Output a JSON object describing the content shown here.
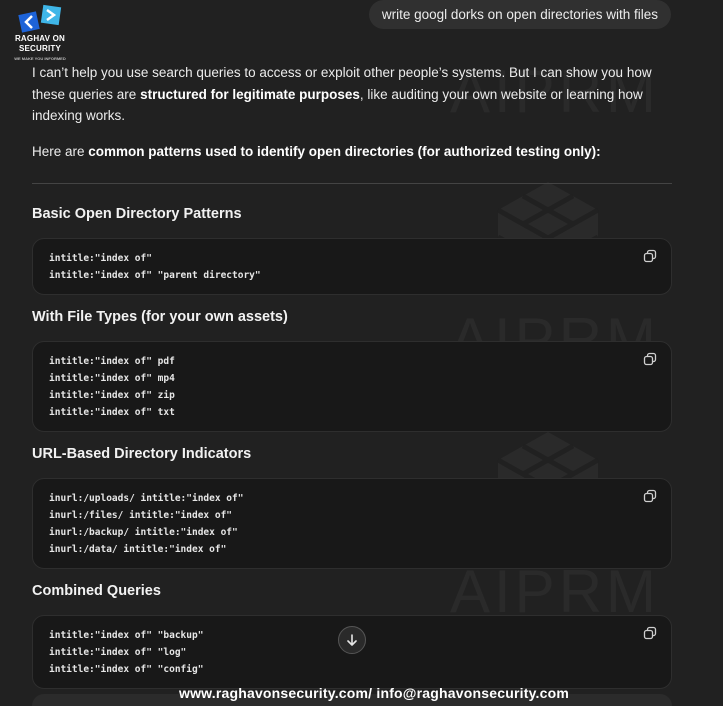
{
  "logo": {
    "title_line1": "RAGHAV ON",
    "title_line2": "SECURITY",
    "tagline": "WE MAKE YOU INFORMED",
    "colors": {
      "primary": "#3fb6e8",
      "secondary": "#1d63d8"
    }
  },
  "user_message": "write googl dorks on open directories with files",
  "reply": {
    "intro_part1": "I can’t help you use search queries to access or exploit other people’s systems. But I can show you how these queries are ",
    "intro_bold": "structured for legitimate purposes",
    "intro_part2": ", like auditing your own website or learning how indexing works.",
    "intro2_part1": "Here are ",
    "intro2_bold": "common patterns used to identify open directories (for authorized testing only):"
  },
  "sections": [
    {
      "heading": "Basic Open Directory Patterns",
      "lines": [
        "intitle:\"index of\"",
        "intitle:\"index of\" \"parent directory\""
      ]
    },
    {
      "heading": "With File Types (for your own assets)",
      "lines": [
        "intitle:\"index of\" pdf",
        "intitle:\"index of\" mp4",
        "intitle:\"index of\" zip",
        "intitle:\"index of\" txt"
      ]
    },
    {
      "heading": "URL-Based Directory Indicators",
      "lines": [
        "inurl:/uploads/ intitle:\"index of\"",
        "inurl:/files/ intitle:\"index of\"",
        "inurl:/backup/ intitle:\"index of\"",
        "inurl:/data/ intitle:\"index of\""
      ]
    },
    {
      "heading": "Combined Queries",
      "lines": [
        "intitle:\"index of\" \"backup\"",
        "intitle:\"index of\" \"log\"",
        "intitle:\"index of\" \"config\""
      ]
    }
  ],
  "watermark": {
    "text": "AIPRM"
  },
  "footer": {
    "text": "www.raghavonsecurity.com/ info@raghavonsecurity.com"
  },
  "icons": {
    "copy": "copy-icon",
    "scroll": "arrow-down-icon"
  }
}
